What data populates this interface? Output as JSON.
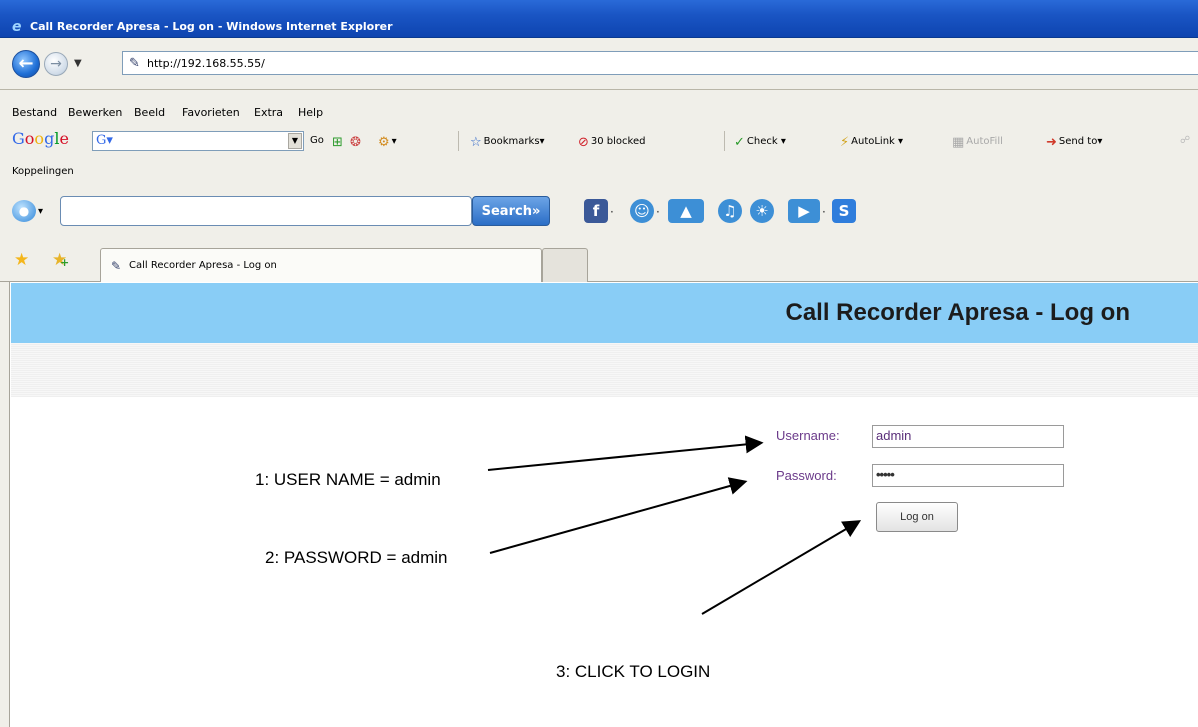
{
  "window": {
    "title": "Call Recorder Apresa - Log on - Windows Internet Explorer"
  },
  "address_bar": {
    "url": "http://192.168.55.55/"
  },
  "menu": {
    "items": [
      "Bestand",
      "Bewerken",
      "Beeld",
      "Favorieten",
      "Extra",
      "Help"
    ]
  },
  "google_toolbar": {
    "logo": "Google",
    "go_label": "Go",
    "bookmarks_label": "Bookmarks",
    "blocked_label": "30 blocked",
    "check_label": "Check",
    "autolink_label": "AutoLink",
    "autofill_label": "AutoFill",
    "sendto_label": "Send to"
  },
  "links_bar": {
    "label": "Koppelingen"
  },
  "custom_toolbar": {
    "search_button": "Search»",
    "search_value": ""
  },
  "tabs": [
    {
      "label": "Call Recorder Apresa - Log on",
      "active": true
    }
  ],
  "page": {
    "header_title": "Call Recorder Apresa - Log on",
    "login": {
      "username_label": "Username:",
      "username_value": "admin",
      "password_label": "Password:",
      "password_value": "•••••",
      "submit_label": "Log on"
    }
  },
  "annotations": {
    "step1": "1: USER NAME = admin",
    "step2": "2: PASSWORD = admin",
    "step3": "3: CLICK TO LOGIN"
  },
  "colors": {
    "title_bar": "#1a55c4",
    "page_header": "#89cdf6",
    "label_text": "#6b3a8a"
  },
  "icons": {
    "ie": "ie-logo-icon",
    "back": "back-arrow-icon",
    "forward": "forward-arrow-icon",
    "page": "page-icon",
    "favorites": "favorites-star-icon",
    "add_favorite": "add-favorite-icon"
  }
}
